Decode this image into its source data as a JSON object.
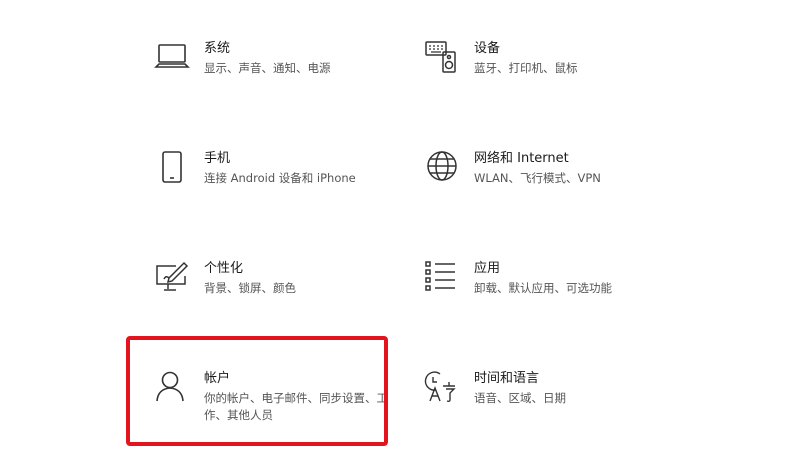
{
  "tiles": [
    {
      "id": "system",
      "title": "系统",
      "desc": "显示、声音、通知、电源",
      "icon": "laptop-icon"
    },
    {
      "id": "devices",
      "title": "设备",
      "desc": "蓝牙、打印机、鼠标",
      "icon": "keyboard-speaker-icon"
    },
    {
      "id": "phone",
      "title": "手机",
      "desc": "连接 Android 设备和 iPhone",
      "icon": "phone-icon"
    },
    {
      "id": "network",
      "title": "网络和 Internet",
      "desc": "WLAN、飞行模式、VPN",
      "icon": "globe-icon"
    },
    {
      "id": "personalization",
      "title": "个性化",
      "desc": "背景、锁屏、颜色",
      "icon": "paint-monitor-icon"
    },
    {
      "id": "apps",
      "title": "应用",
      "desc": "卸载、默认应用、可选功能",
      "icon": "app-list-icon"
    },
    {
      "id": "accounts",
      "title": "帐户",
      "desc": "你的帐户、电子邮件、同步设置、工作、其他人员",
      "icon": "person-icon"
    },
    {
      "id": "time-language",
      "title": "时间和语言",
      "desc": "语音、区域、日期",
      "icon": "time-language-icon"
    }
  ],
  "highlight": {
    "target": "accounts",
    "color": "#e3141d"
  }
}
